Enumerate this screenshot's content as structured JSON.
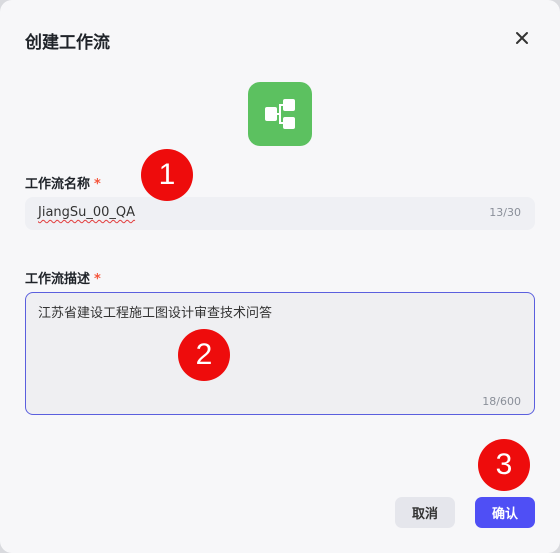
{
  "dialog": {
    "title": "创建工作流",
    "close_icon": "close-icon",
    "hero_icon": "workflow-icon",
    "hero_color": "#5cc160"
  },
  "name_field": {
    "label": "工作流名称",
    "required_mark": "*",
    "value": "JiangSu_00_QA",
    "count": "13/30"
  },
  "desc_field": {
    "label": "工作流描述",
    "required_mark": "*",
    "value": "江苏省建设工程施工图设计审查技术问答",
    "count": "18/600"
  },
  "markers": [
    "1",
    "2",
    "3"
  ],
  "buttons": {
    "cancel": "取消",
    "confirm": "确认",
    "confirm_color": "#4f4ff5"
  }
}
